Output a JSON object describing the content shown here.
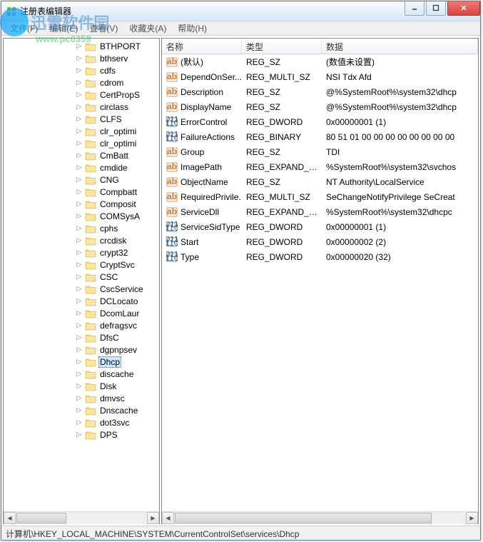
{
  "watermark": {
    "brand": "迅雷软件园",
    "url": "www.pc0359"
  },
  "window": {
    "title": "注册表编辑器"
  },
  "menu": {
    "file": "文件(F)",
    "edit": "编辑(E)",
    "view": "查看(V)",
    "favorites": "收藏夹(A)",
    "help": "帮助(H)"
  },
  "columns": {
    "name": "名称",
    "type": "类型",
    "data": "数据"
  },
  "tree": [
    {
      "label": "BTHPORT",
      "exp": "▷"
    },
    {
      "label": "bthserv",
      "exp": "▷"
    },
    {
      "label": "cdfs",
      "exp": "▷"
    },
    {
      "label": "cdrom",
      "exp": "▷"
    },
    {
      "label": "CertPropS",
      "exp": "▷"
    },
    {
      "label": "circlass",
      "exp": "▷"
    },
    {
      "label": "CLFS",
      "exp": "▷"
    },
    {
      "label": "clr_optimi",
      "exp": "▷"
    },
    {
      "label": "clr_optimi",
      "exp": "▷"
    },
    {
      "label": "CmBatt",
      "exp": "▷"
    },
    {
      "label": "cmdide",
      "exp": "▷"
    },
    {
      "label": "CNG",
      "exp": "▷"
    },
    {
      "label": "Compbatt",
      "exp": "▷"
    },
    {
      "label": "Composit",
      "exp": "▷"
    },
    {
      "label": "COMSysA",
      "exp": "▷"
    },
    {
      "label": "cphs",
      "exp": "▷"
    },
    {
      "label": "crcdisk",
      "exp": "▷"
    },
    {
      "label": "crypt32",
      "exp": "▷"
    },
    {
      "label": "CryptSvc",
      "exp": "▷"
    },
    {
      "label": "CSC",
      "exp": "▷"
    },
    {
      "label": "CscService",
      "exp": "▷"
    },
    {
      "label": "DCLocato",
      "exp": "▷"
    },
    {
      "label": "DcomLaur",
      "exp": "▷"
    },
    {
      "label": "defragsvc",
      "exp": "▷"
    },
    {
      "label": "DfsC",
      "exp": "▷"
    },
    {
      "label": "dgpnpsev",
      "exp": "▷"
    },
    {
      "label": "Dhcp",
      "exp": "▷",
      "selected": true
    },
    {
      "label": "discache",
      "exp": "▷"
    },
    {
      "label": "Disk",
      "exp": "▷"
    },
    {
      "label": "dmvsc",
      "exp": "▷"
    },
    {
      "label": "Dnscache",
      "exp": "▷"
    },
    {
      "label": "dot3svc",
      "exp": "▷"
    },
    {
      "label": "DPS",
      "exp": "▷"
    }
  ],
  "values": [
    {
      "icon": "sz",
      "name": "(默认)",
      "type": "REG_SZ",
      "data": "(数值未设置)"
    },
    {
      "icon": "sz",
      "name": "DependOnSer...",
      "type": "REG_MULTI_SZ",
      "data": "NSI Tdx Afd"
    },
    {
      "icon": "sz",
      "name": "Description",
      "type": "REG_SZ",
      "data": "@%SystemRoot%\\system32\\dhcp"
    },
    {
      "icon": "sz",
      "name": "DisplayName",
      "type": "REG_SZ",
      "data": "@%SystemRoot%\\system32\\dhcp"
    },
    {
      "icon": "bin",
      "name": "ErrorControl",
      "type": "REG_DWORD",
      "data": "0x00000001 (1)"
    },
    {
      "icon": "bin",
      "name": "FailureActions",
      "type": "REG_BINARY",
      "data": "80 51 01 00 00 00 00 00 00 00 00"
    },
    {
      "icon": "sz",
      "name": "Group",
      "type": "REG_SZ",
      "data": "TDI"
    },
    {
      "icon": "sz",
      "name": "ImagePath",
      "type": "REG_EXPAND_SZ",
      "data": "%SystemRoot%\\system32\\svchos"
    },
    {
      "icon": "sz",
      "name": "ObjectName",
      "type": "REG_SZ",
      "data": "NT Authority\\LocalService"
    },
    {
      "icon": "sz",
      "name": "RequiredPrivile...",
      "type": "REG_MULTI_SZ",
      "data": "SeChangeNotifyPrivilege SeCreat"
    },
    {
      "icon": "sz",
      "name": "ServiceDll",
      "type": "REG_EXPAND_SZ",
      "data": "%SystemRoot%\\system32\\dhcpc"
    },
    {
      "icon": "bin",
      "name": "ServiceSidType",
      "type": "REG_DWORD",
      "data": "0x00000001 (1)"
    },
    {
      "icon": "bin",
      "name": "Start",
      "type": "REG_DWORD",
      "data": "0x00000002 (2)"
    },
    {
      "icon": "bin",
      "name": "Type",
      "type": "REG_DWORD",
      "data": "0x00000020 (32)"
    }
  ],
  "statusbar": "计算机\\HKEY_LOCAL_MACHINE\\SYSTEM\\CurrentControlSet\\services\\Dhcp"
}
